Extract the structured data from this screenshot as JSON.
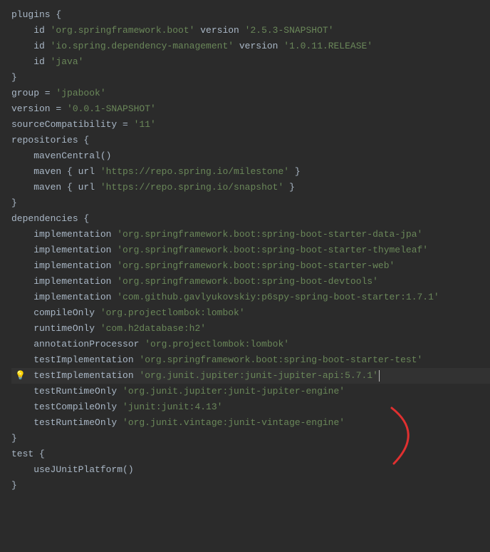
{
  "lines": {
    "l1_kw": "plugins {",
    "l2_a": "    id ",
    "l2_s": "'org.springframework.boot'",
    "l2_b": " version ",
    "l2_s2": "'2.5.3-SNAPSHOT'",
    "l3_a": "    id ",
    "l3_s": "'io.spring.dependency-management'",
    "l3_b": " version ",
    "l3_s2": "'1.0.11.RELEASE'",
    "l4_a": "    id ",
    "l4_s": "'java'",
    "l5": "}",
    "l6": "",
    "l7_a": "group = ",
    "l7_s": "'jpabook'",
    "l8_a": "version = ",
    "l8_s": "'0.0.1-SNAPSHOT'",
    "l9_a": "sourceCompatibility = ",
    "l9_s": "'11'",
    "l10": "",
    "l11": "repositories {",
    "l12": "    mavenCentral()",
    "l13_a": "    maven { url ",
    "l13_s": "'https://repo.spring.io/milestone'",
    "l13_b": " }",
    "l14_a": "    maven { url ",
    "l14_s": "'https://repo.spring.io/snapshot'",
    "l14_b": " }",
    "l15": "}",
    "l16": "",
    "l17": "dependencies {",
    "l18_a": "    implementation ",
    "l18_s": "'org.springframework.boot:spring-boot-starter-data-jpa'",
    "l19_a": "    implementation ",
    "l19_s": "'org.springframework.boot:spring-boot-starter-thymeleaf'",
    "l20_a": "    implementation ",
    "l20_s": "'org.springframework.boot:spring-boot-starter-web'",
    "l21_a": "    implementation ",
    "l21_s": "'org.springframework.boot:spring-boot-devtools'",
    "l22_a": "    implementation ",
    "l22_s": "'com.github.gavlyukovskiy:p6spy-spring-boot-starter:1.7.1'",
    "l23_a": "    compileOnly ",
    "l23_s": "'org.projectlombok:lombok'",
    "l24_a": "    runtimeOnly ",
    "l24_s": "'com.h2database:h2'",
    "l25_a": "    annotationProcessor ",
    "l25_s": "'org.projectlombok:lombok'",
    "l26_a": "    testImplementation ",
    "l26_s": "'org.springframework.boot:spring-boot-starter-test'",
    "l27_a": "    testImplementation ",
    "l27_s": "'org.junit.jupiter:junit-jupiter-api:5.7.1'",
    "l28_a": "    testRuntimeOnly ",
    "l28_s": "'org.junit.jupiter:junit-jupiter-engine'",
    "l29_a": "    testCompileOnly ",
    "l29_s": "'junit:junit:4.13'",
    "l30_a": "    testRuntimeOnly ",
    "l30_s": "'org.junit.vintage:junit-vintage-engine'",
    "l31": "}",
    "l32": "",
    "l33": "test {",
    "l34": "    useJUnitPlatform()",
    "l35": "}"
  },
  "icons": {
    "bulb": "💡"
  }
}
